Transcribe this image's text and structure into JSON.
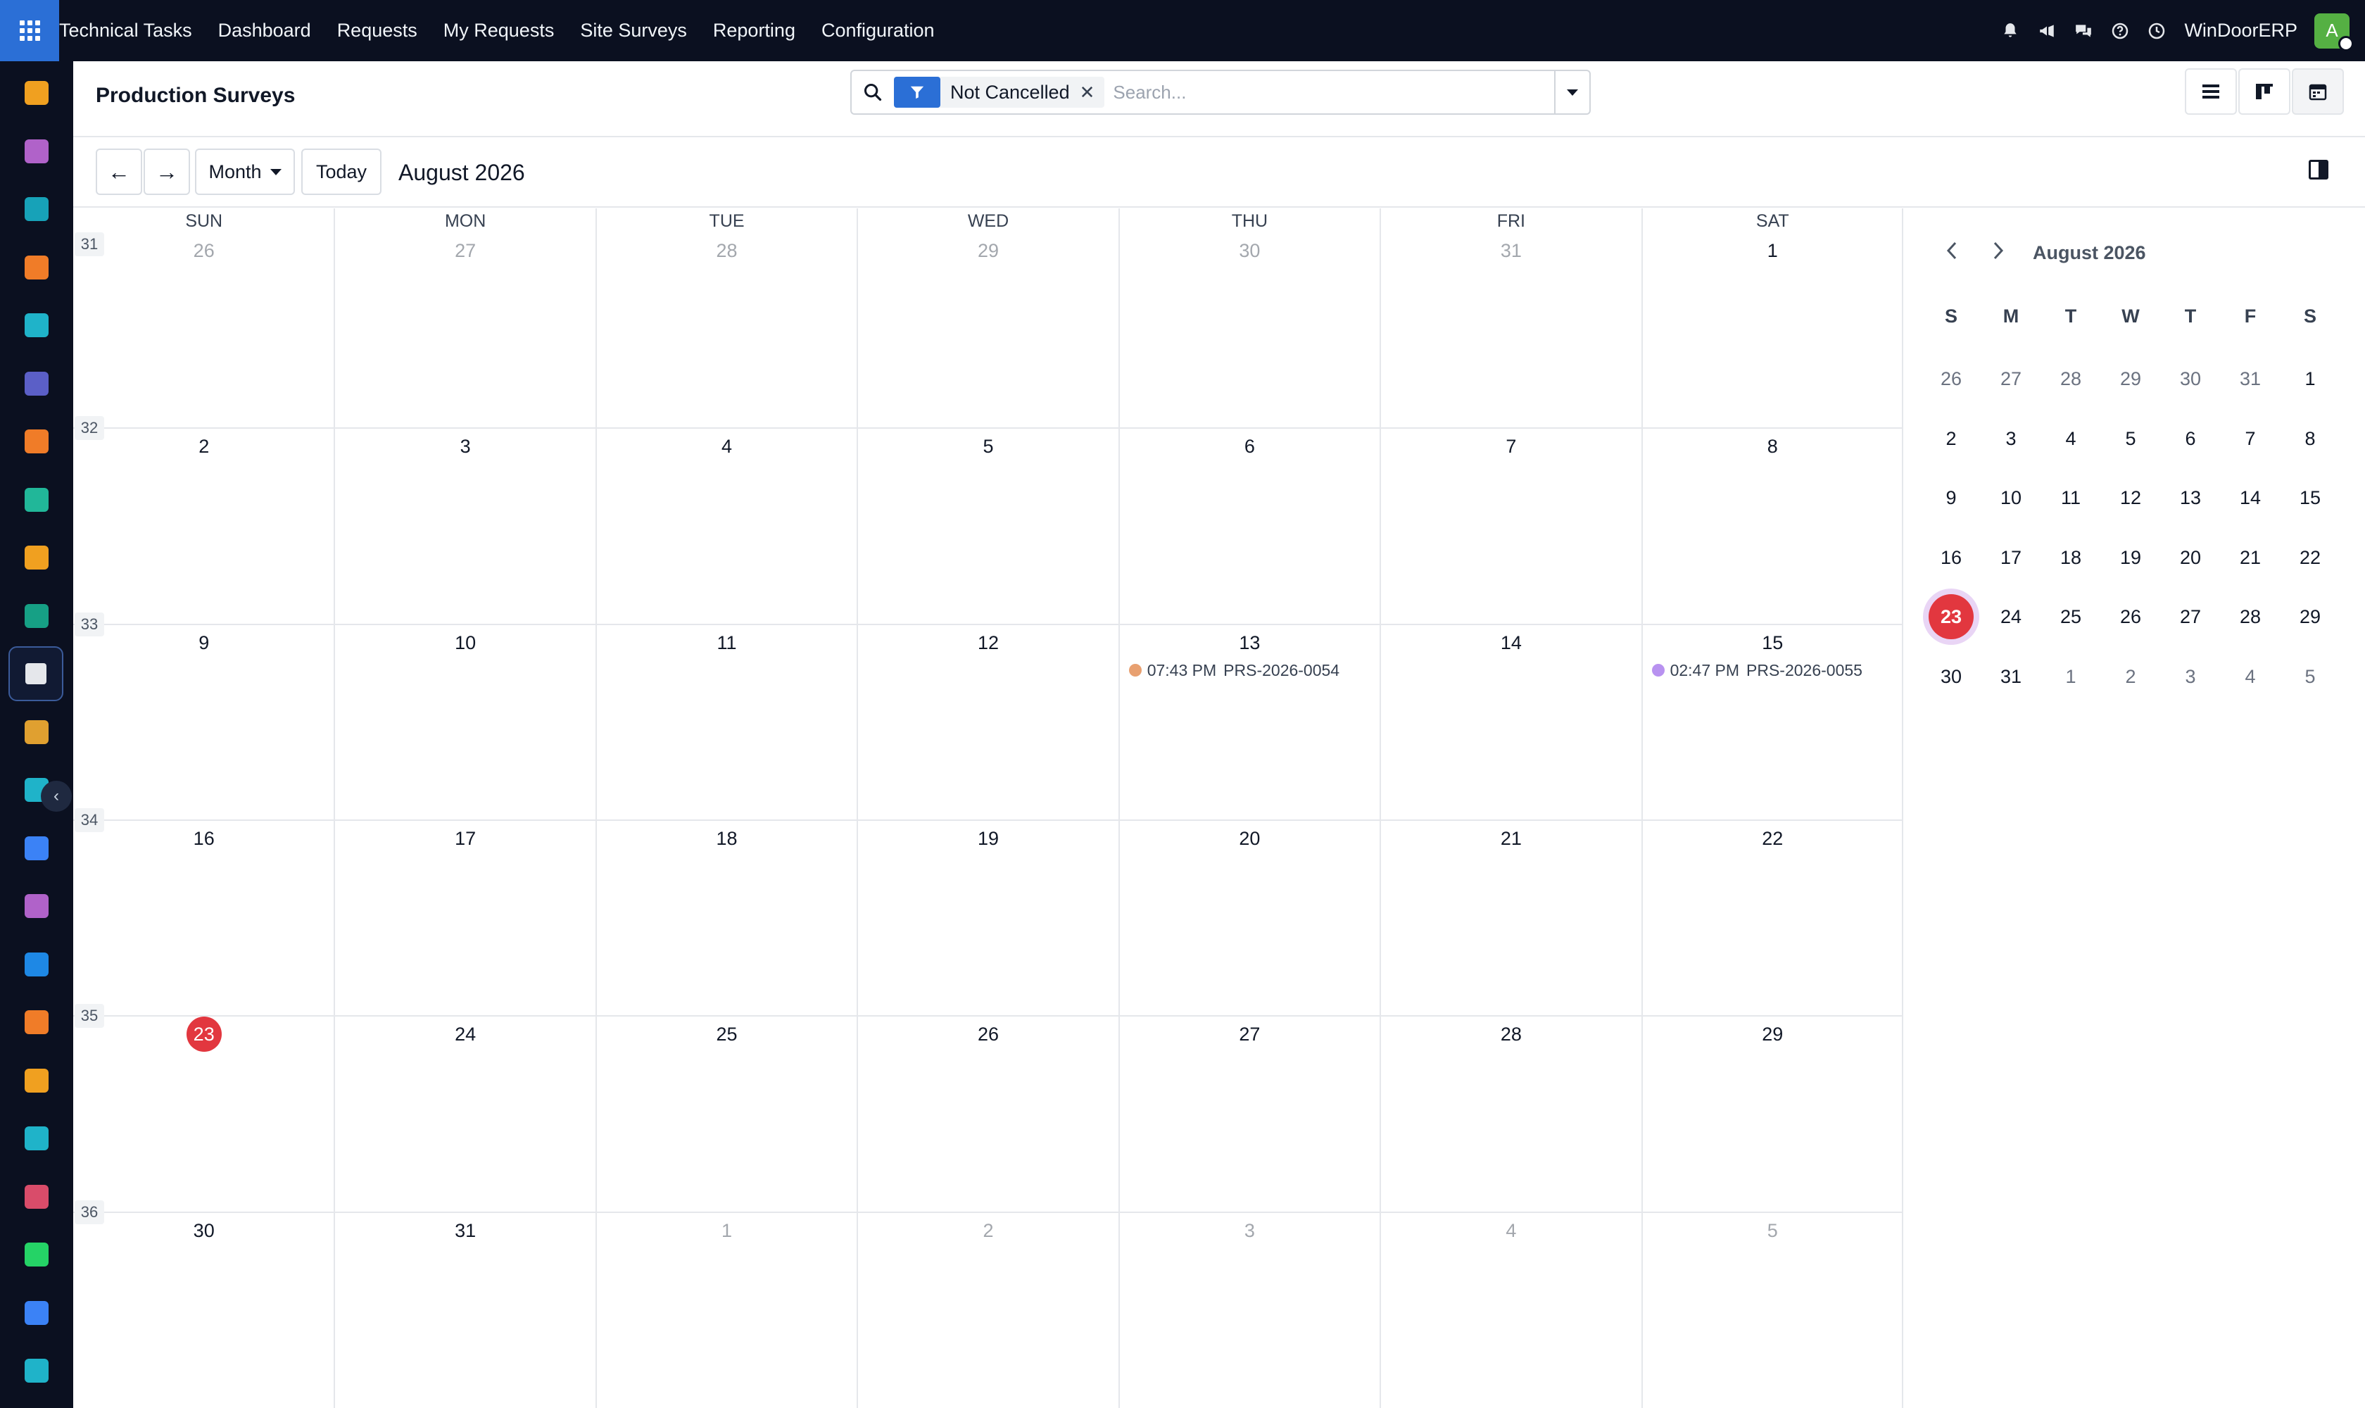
{
  "nav": {
    "items": [
      "Technical Tasks",
      "Dashboard",
      "Requests",
      "My Requests",
      "Site Surveys",
      "Reporting",
      "Configuration"
    ],
    "company": "WinDoorERP",
    "avatar_letter": "A"
  },
  "rail": {
    "icons": [
      {
        "name": "bar-chart-app-icon",
        "color": "#f0a020"
      },
      {
        "name": "sales-app-icon",
        "color": "#b062c9"
      },
      {
        "name": "contacts-app-icon",
        "color": "#17a2b8"
      },
      {
        "name": "discuss-app-icon",
        "color": "#f07c28"
      },
      {
        "name": "website-app-icon",
        "color": "#1fb3c9"
      },
      {
        "name": "email-marketing-app-icon",
        "color": "#5b5fc7"
      },
      {
        "name": "livechat-app-icon",
        "color": "#f07c28"
      },
      {
        "name": "vendors-app-icon",
        "color": "#21b799"
      },
      {
        "name": "reports-app-icon",
        "color": "#f0a020"
      },
      {
        "name": "employees-app-icon",
        "color": "#16a085"
      },
      {
        "name": "surveys-app-icon",
        "color": "#e5e7eb"
      },
      {
        "name": "field-service-app-icon",
        "color": "#e0a030"
      },
      {
        "name": "project-app-icon",
        "color": "#1fb3c9"
      },
      {
        "name": "knowledge-app-icon",
        "color": "#3b82f6"
      },
      {
        "name": "inventory-app-icon",
        "color": "#b062c9"
      },
      {
        "name": "invoicing-app-icon",
        "color": "#1e88e5"
      },
      {
        "name": "crm-app-icon",
        "color": "#f07c28"
      },
      {
        "name": "calendar-app-icon",
        "color": "#f0a020"
      },
      {
        "name": "sign-app-icon",
        "color": "#1fb3c9"
      },
      {
        "name": "dashboards-app-icon",
        "color": "#d94c6a"
      },
      {
        "name": "whatsapp-app-icon",
        "color": "#25d366"
      },
      {
        "name": "timesheet-app-icon",
        "color": "#3b82f6"
      },
      {
        "name": "website2-app-icon",
        "color": "#1fb3c9"
      }
    ],
    "active_index": 10
  },
  "control_panel": {
    "title": "Production Surveys",
    "facet_label": "Not Cancelled",
    "search_placeholder": "Search..."
  },
  "toolbar": {
    "prev_label": "←",
    "next_label": "→",
    "scale_label": "Month",
    "today_label": "Today",
    "range_title": "August 2026"
  },
  "calendar": {
    "weekdays": [
      "SUN",
      "MON",
      "TUE",
      "WED",
      "THU",
      "FRI",
      "SAT"
    ],
    "weeks": [
      {
        "num": "31",
        "days": [
          {
            "d": "26",
            "muted": true
          },
          {
            "d": "27",
            "muted": true
          },
          {
            "d": "28",
            "muted": true
          },
          {
            "d": "29",
            "muted": true
          },
          {
            "d": "30",
            "muted": true
          },
          {
            "d": "31",
            "muted": true
          },
          {
            "d": "1"
          }
        ]
      },
      {
        "num": "32",
        "days": [
          {
            "d": "2"
          },
          {
            "d": "3"
          },
          {
            "d": "4"
          },
          {
            "d": "5"
          },
          {
            "d": "6"
          },
          {
            "d": "7"
          },
          {
            "d": "8"
          }
        ]
      },
      {
        "num": "33",
        "days": [
          {
            "d": "9"
          },
          {
            "d": "10"
          },
          {
            "d": "11"
          },
          {
            "d": "12"
          },
          {
            "d": "13"
          },
          {
            "d": "14"
          },
          {
            "d": "15"
          }
        ]
      },
      {
        "num": "34",
        "days": [
          {
            "d": "16"
          },
          {
            "d": "17"
          },
          {
            "d": "18"
          },
          {
            "d": "19"
          },
          {
            "d": "20"
          },
          {
            "d": "21"
          },
          {
            "d": "22"
          }
        ]
      },
      {
        "num": "35",
        "days": [
          {
            "d": "23",
            "today": true
          },
          {
            "d": "24"
          },
          {
            "d": "25"
          },
          {
            "d": "26"
          },
          {
            "d": "27"
          },
          {
            "d": "28"
          },
          {
            "d": "29"
          }
        ]
      },
      {
        "num": "36",
        "days": [
          {
            "d": "30"
          },
          {
            "d": "31"
          },
          {
            "d": "1",
            "muted": true
          },
          {
            "d": "2",
            "muted": true
          },
          {
            "d": "3",
            "muted": true
          },
          {
            "d": "4",
            "muted": true
          },
          {
            "d": "5",
            "muted": true
          }
        ]
      }
    ],
    "events": [
      {
        "week": 2,
        "day": 4,
        "time": "07:43 PM",
        "ref": "PRS-2026-0054",
        "color": "#e8a070"
      },
      {
        "week": 2,
        "day": 6,
        "time": "02:47 PM",
        "ref": "PRS-2026-0055",
        "color": "#b892f0"
      }
    ],
    "today_color": "#e2373f"
  },
  "mini_calendar": {
    "title": "August 2026",
    "weekdays": [
      "S",
      "M",
      "T",
      "W",
      "T",
      "F",
      "S"
    ],
    "weeks": [
      [
        {
          "d": "26",
          "muted": true
        },
        {
          "d": "27",
          "muted": true
        },
        {
          "d": "28",
          "muted": true
        },
        {
          "d": "29",
          "muted": true
        },
        {
          "d": "30",
          "muted": true
        },
        {
          "d": "31",
          "muted": true
        },
        {
          "d": "1"
        }
      ],
      [
        {
          "d": "2"
        },
        {
          "d": "3"
        },
        {
          "d": "4"
        },
        {
          "d": "5"
        },
        {
          "d": "6"
        },
        {
          "d": "7"
        },
        {
          "d": "8"
        }
      ],
      [
        {
          "d": "9"
        },
        {
          "d": "10"
        },
        {
          "d": "11"
        },
        {
          "d": "12"
        },
        {
          "d": "13"
        },
        {
          "d": "14"
        },
        {
          "d": "15"
        }
      ],
      [
        {
          "d": "16"
        },
        {
          "d": "17"
        },
        {
          "d": "18"
        },
        {
          "d": "19"
        },
        {
          "d": "20"
        },
        {
          "d": "21"
        },
        {
          "d": "22"
        }
      ],
      [
        {
          "d": "23",
          "today": true
        },
        {
          "d": "24"
        },
        {
          "d": "25"
        },
        {
          "d": "26"
        },
        {
          "d": "27"
        },
        {
          "d": "28"
        },
        {
          "d": "29"
        }
      ],
      [
        {
          "d": "30"
        },
        {
          "d": "31"
        },
        {
          "d": "1",
          "muted": true
        },
        {
          "d": "2",
          "muted": true
        },
        {
          "d": "3",
          "muted": true
        },
        {
          "d": "4",
          "muted": true
        },
        {
          "d": "5",
          "muted": true
        }
      ]
    ]
  }
}
